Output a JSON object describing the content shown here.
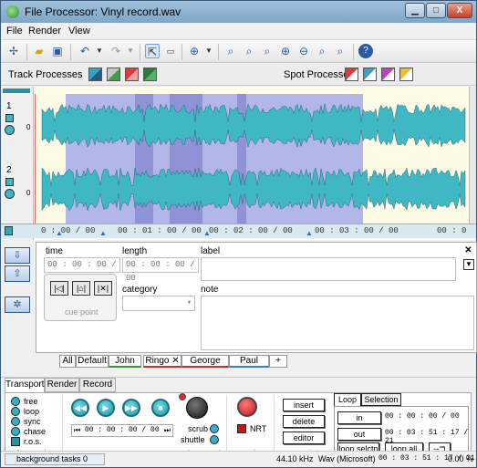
{
  "window": {
    "title": "File Processor: Vinyl record.wav",
    "minimize": "▁",
    "maximize": "□",
    "close": "X"
  },
  "menu": {
    "file": "File",
    "render": "Render",
    "view": "View"
  },
  "processes": {
    "track_label": "Track Processes",
    "spot_label": "Spot Processes"
  },
  "tracks": {
    "track1": "1",
    "track2": "2",
    "zero": "0"
  },
  "ruler": {
    "ticks": [
      "0 : 00 / 00",
      "00 : 01 : 00 / 00",
      "00 : 02 : 00 / 00",
      "00 : 03 : 00 / 00",
      "00 : 0"
    ]
  },
  "marker": {
    "time_label": "time",
    "length_label": "length",
    "label_label": "label",
    "category_label": "category",
    "note_label": "note",
    "time_value": "00 : 00 : 00 / 00",
    "length_value": "00 : 00 : 00 / 00",
    "cue_point_label": "cue point"
  },
  "filter_tabs": [
    {
      "label": "All",
      "color": "#6a6a6a"
    },
    {
      "label": "Default",
      "color": "#6a6a6a"
    },
    {
      "label": "John",
      "color": "#2e9e2e"
    },
    {
      "label": "Ringo ✕",
      "color": "#d42a2a"
    },
    {
      "label": "George",
      "color": "#d42a2a"
    },
    {
      "label": "Paul",
      "color": "#2e86c8"
    },
    {
      "label": "+",
      "color": "#6a6a6a"
    }
  ],
  "transport_tabs": {
    "transport": "Transport",
    "render": "Render",
    "record": "Record"
  },
  "play_mode": {
    "free": "free",
    "loop": "loop",
    "sync": "sync",
    "chase": "chase",
    "ros": "r.o.s.",
    "section_label": "play mode"
  },
  "transport": {
    "time": "00 : 00 : 00 / 00",
    "scrub": "scrub",
    "shuttle": "shuttle",
    "section_label": "transport"
  },
  "render_section": {
    "nrt": "NRT",
    "section_label": "render"
  },
  "cue_points": {
    "insert": "insert",
    "delete": "delete",
    "editor": "editor",
    "section_label": "cue points"
  },
  "loop_panel": {
    "loop_tab": "Loop",
    "selection_tab": "Selection",
    "in_label": "in",
    "in_time": "00 : 00 : 00 / 00",
    "out_label": "out",
    "out_time": "00 : 03 : 51 : 17 / 21",
    "loop_selctn": "loop selctn",
    "loop_all": "loop all",
    "toggle_glyph": "--⊐"
  },
  "status": {
    "background_tasks": "background tasks 0",
    "sample_rate": "44.10 kHz",
    "format": "Wav (Microsoft)",
    "duration": "00 : 03 : 51 : 17 / 21",
    "percent": "0.00 %"
  },
  "colors": {
    "waveform": "#3fb8c4",
    "selection": "#b3b6e8",
    "playhead": "#d42a2a"
  }
}
